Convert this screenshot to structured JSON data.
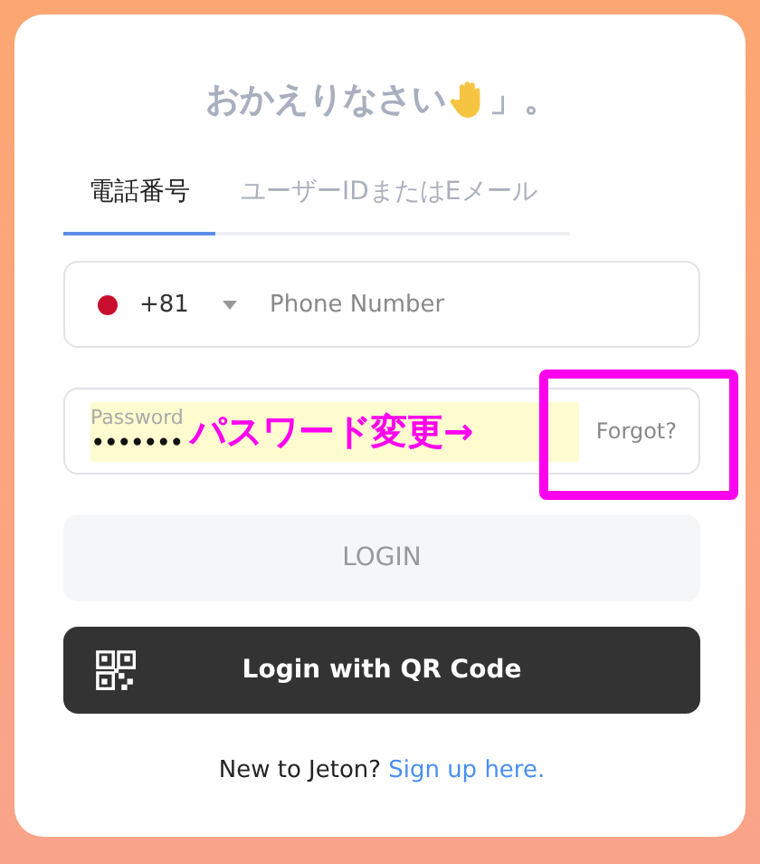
{
  "title": {
    "text": "おかえりなさい",
    "suffix": "」。"
  },
  "tabs": [
    {
      "label": "電話番号",
      "selected": true
    },
    {
      "label": "ユーザーIDまたはEメール",
      "selected": false
    }
  ],
  "phone": {
    "country_code": "+81",
    "placeholder": "Phone Number"
  },
  "password": {
    "label": "Password",
    "value": "•••••••",
    "forgot": "Forgot?"
  },
  "annotation": {
    "text": "パスワード変更→"
  },
  "buttons": [
    {
      "label": "LOGIN",
      "kind": "disabled"
    },
    {
      "label": "Login with QR Code",
      "kind": "qr"
    }
  ],
  "footer": {
    "text": "New to Jeton?",
    "link": "Sign up here."
  }
}
